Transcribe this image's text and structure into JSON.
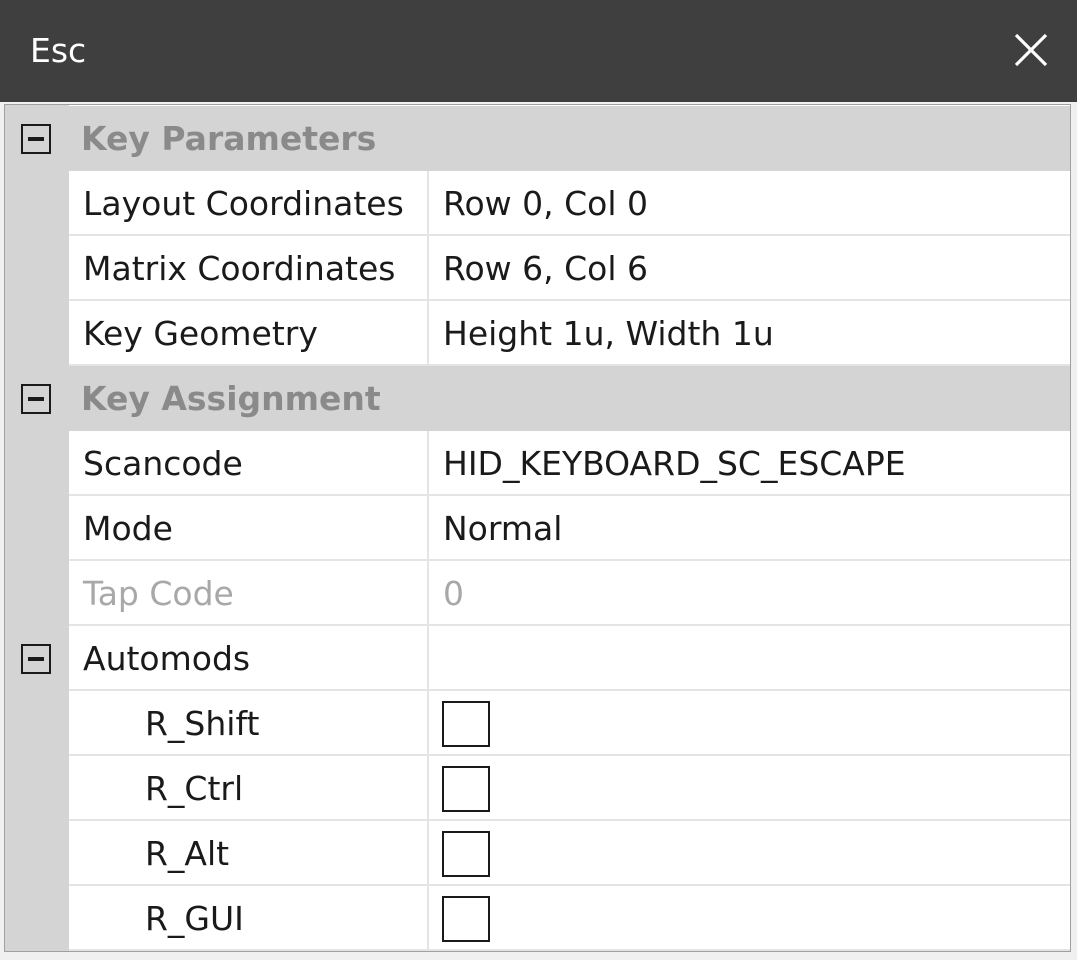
{
  "window": {
    "title": "Esc",
    "close_icon": "close-icon"
  },
  "categories": {
    "key_parameters": {
      "label": "Key Parameters",
      "properties": [
        {
          "name": "Layout Coordinates",
          "value": "Row 0, Col 0"
        },
        {
          "name": "Matrix Coordinates",
          "value": "Row 6, Col 6"
        },
        {
          "name": "Key Geometry",
          "value": "Height 1u, Width 1u"
        }
      ]
    },
    "key_assignment": {
      "label": "Key Assignment",
      "properties": [
        {
          "name": "Scancode",
          "value": "HID_KEYBOARD_SC_ESCAPE"
        },
        {
          "name": "Mode",
          "value": "Normal"
        },
        {
          "name": "Tap Code",
          "value": "0",
          "disabled": true
        }
      ],
      "automods": {
        "name": "Automods",
        "items": [
          {
            "name": "R_Shift",
            "checked": false
          },
          {
            "name": "R_Ctrl",
            "checked": false
          },
          {
            "name": "R_Alt",
            "checked": false
          },
          {
            "name": "R_GUI",
            "checked": false
          }
        ]
      }
    }
  },
  "colors": {
    "titlebar": "#3f3f3f",
    "category_background": "#d4d4d4",
    "category_text": "#8a8a8a",
    "disabled_text": "#a8a8a8"
  }
}
